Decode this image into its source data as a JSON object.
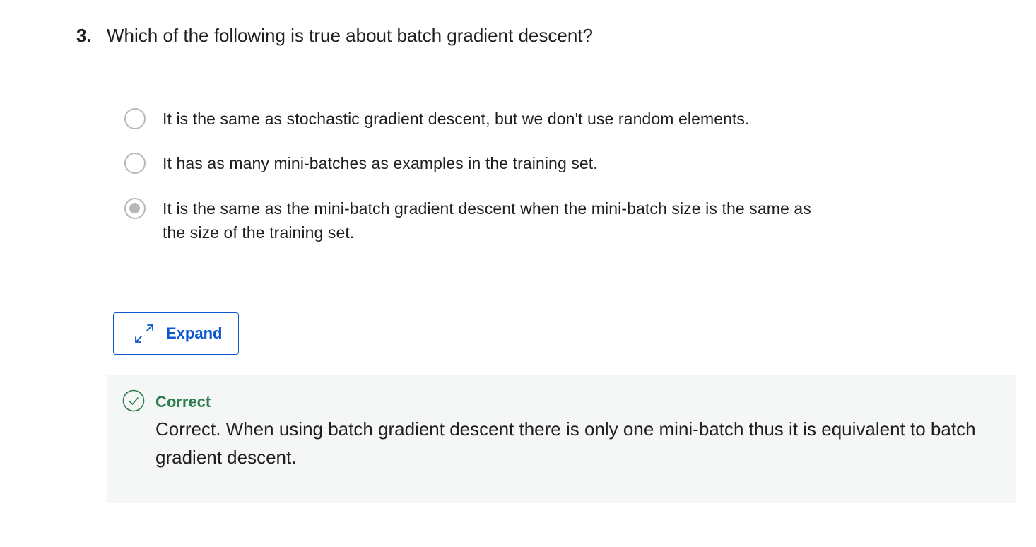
{
  "question": {
    "number": "3.",
    "text": "Which of the following is true about batch gradient descent?"
  },
  "options": [
    {
      "label": "It is the same as stochastic gradient descent, but we don't use random elements.",
      "selected": false
    },
    {
      "label": "It has as many mini-batches as examples in the training set.",
      "selected": false
    },
    {
      "label": "It is the same as the mini-batch gradient descent when the mini-batch size is the same as the size of the training set.",
      "selected": true
    }
  ],
  "expand_button": {
    "label": "Expand",
    "icon": "expand-arrows-icon"
  },
  "feedback": {
    "status_icon": "check-circle-icon",
    "title": "Correct",
    "text": "Correct. When using batch gradient descent there is only one mini-batch thus it is equivalent to batch gradient descent."
  },
  "colors": {
    "accent": "#0b56d1",
    "success": "#2e7d4f",
    "radio": "#b8b8b8",
    "feedback_bg": "#f5f7f6"
  }
}
